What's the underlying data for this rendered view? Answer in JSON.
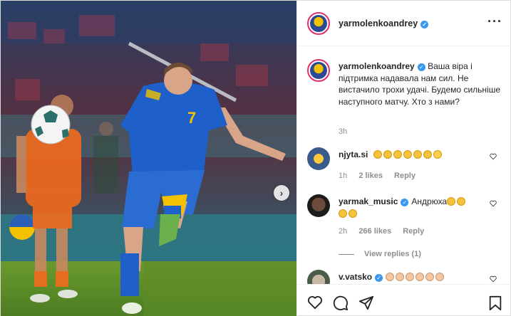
{
  "post": {
    "username": "yarmolenkoandrey",
    "more_icon": "more-horizontal-icon"
  },
  "photo": {
    "player_number": "7",
    "shirt_color": "#1f5fc9",
    "opponent_color": "#f26b1d"
  },
  "caption": {
    "username": "yarmolenkoandrey",
    "text": "Ваша віра і підтримка надавала нам сил. Не вистачило трохи удачі. Будемо сильніше наступного матчу. Хто з нами?",
    "time": "3h"
  },
  "comments": [
    {
      "username": "njyta.si",
      "text": "",
      "emojis": [
        "clap",
        "clap",
        "clap",
        "clap",
        "clap",
        "clap",
        "hug"
      ],
      "time": "1h",
      "likes": "2 likes",
      "reply": "Reply"
    },
    {
      "username": "yarmak_music",
      "text": "Андрюха",
      "emojis": [
        "clap",
        "clap",
        "clap",
        "clap"
      ],
      "time": "2h",
      "likes": "266 likes",
      "reply": "Reply",
      "view_replies": "View replies (1)"
    },
    {
      "username": "v.vatsko",
      "text": "",
      "emojis": [
        "clap",
        "clap",
        "clap",
        "muscle",
        "muscle",
        "muscle"
      ]
    }
  ],
  "actions": {
    "like_icon": "heart-icon",
    "comment_icon": "comment-icon",
    "share_icon": "share-icon",
    "save_icon": "bookmark-icon"
  },
  "colors": {
    "verified": "#3897f0",
    "muted": "#8e8e8e",
    "text": "#262626"
  }
}
